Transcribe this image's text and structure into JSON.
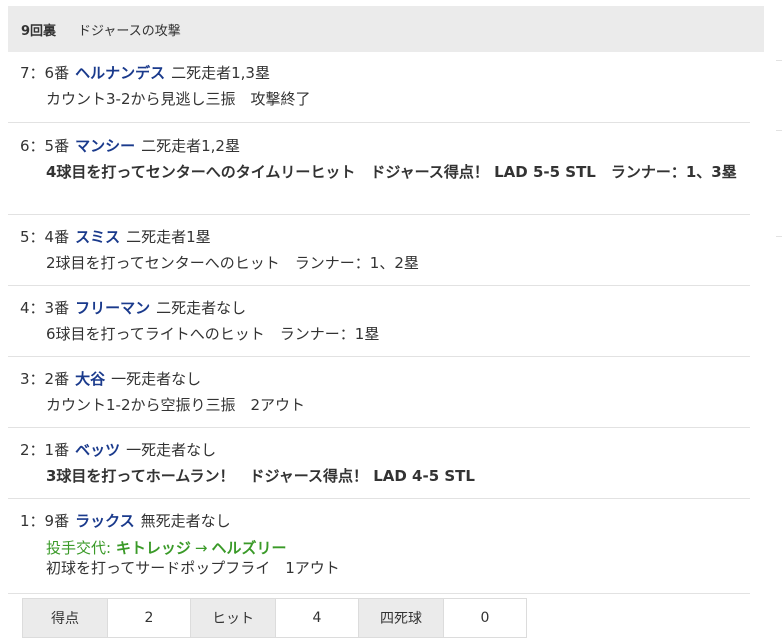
{
  "header": {
    "inning": "9回裏",
    "team_attack": "ドジャースの攻撃"
  },
  "plays": [
    {
      "seq": "7：6番",
      "player": "ヘルナンデス",
      "situation": "二死走者1,3塁",
      "desc": "カウント3-2から見逃し三振　攻撃終了",
      "bold": false
    },
    {
      "seq": "6：5番",
      "player": "マンシー",
      "situation": "二死走者1,2塁",
      "desc": "4球目を打ってセンターへのタイムリーヒット　ドジャース得点！ LAD 5-5 STL　ランナー：1、3塁",
      "bold": true
    },
    {
      "seq": "5：4番",
      "player": "スミス",
      "situation": "二死走者1塁",
      "desc": "2球目を打ってセンターへのヒット　ランナー：1、2塁",
      "bold": false
    },
    {
      "seq": "4：3番",
      "player": "フリーマン",
      "situation": "二死走者なし",
      "desc": "6球目を打ってライトへのヒット　ランナー：1塁",
      "bold": false
    },
    {
      "seq": "3：2番",
      "player": "大谷",
      "situation": "一死走者なし",
      "desc": "カウント1-2から空振り三振　2アウト",
      "bold": false
    },
    {
      "seq": "2：1番",
      "player": "ベッツ",
      "situation": "一死走者なし",
      "desc": "3球目を打ってホームラン！　ドジャース得点！ LAD 4-5 STL",
      "bold": true
    },
    {
      "seq": "1：9番",
      "player": "ラックス",
      "situation": "無死走者なし",
      "substitution": {
        "label": "投手交代:",
        "from": "キトレッジ",
        "arrow": "→",
        "to": "ヘルズリー"
      },
      "desc": "初球を打ってサードポップフライ　1アウト",
      "bold": false
    }
  ],
  "stats": {
    "runs_label": "得点",
    "runs": "2",
    "hits_label": "ヒット",
    "hits": "4",
    "walks_label": "四死球",
    "walks": "0"
  },
  "colors": {
    "player_name": "#1a3a8c",
    "substitution": "#3a9a28",
    "header_bg": "#ebebeb"
  }
}
